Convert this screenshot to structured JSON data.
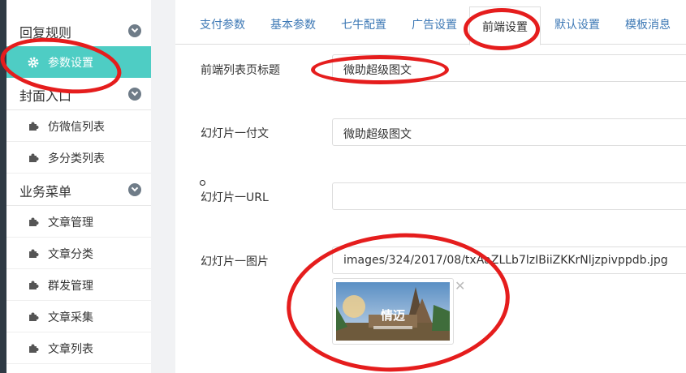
{
  "sidebar": {
    "groups": [
      {
        "label": "回复规则"
      },
      {
        "label": "封面入口"
      },
      {
        "label": "业务菜单"
      }
    ],
    "items": [
      {
        "label": "参数设置",
        "icon": "gear-icon"
      },
      {
        "label": "仿微信列表",
        "icon": "puzzle-icon"
      },
      {
        "label": "多分类列表",
        "icon": "puzzle-icon"
      },
      {
        "label": "文章管理",
        "icon": "puzzle-icon"
      },
      {
        "label": "文章分类",
        "icon": "puzzle-icon"
      },
      {
        "label": "群发管理",
        "icon": "puzzle-icon"
      },
      {
        "label": "文章采集",
        "icon": "puzzle-icon"
      },
      {
        "label": "文章列表",
        "icon": "puzzle-icon"
      }
    ]
  },
  "tabs": [
    {
      "label": "支付参数"
    },
    {
      "label": "基本参数"
    },
    {
      "label": "七牛配置"
    },
    {
      "label": "广告设置"
    },
    {
      "label": "前端设置"
    },
    {
      "label": "默认设置"
    },
    {
      "label": "模板消息"
    }
  ],
  "form": {
    "title_label": "前端列表页标题",
    "title_value": "微助超级图文",
    "subtitle_label": "幻灯片一付文",
    "subtitle_value": "微助超级图文",
    "url_label": "幻灯片一URL",
    "url_value": "",
    "image_label": "幻灯片一图片",
    "image_value": "images/324/2017/08/txAaZLLb7lzIBiiZKKrNljzpivppdb.jpg",
    "thumb_caption": "情迈",
    "thumb_close": "✕"
  },
  "colors": {
    "accent": "#4ecdc4",
    "link": "#3d78b5",
    "annotation": "#e51d1d",
    "dark_strip": "#2f3a44"
  }
}
